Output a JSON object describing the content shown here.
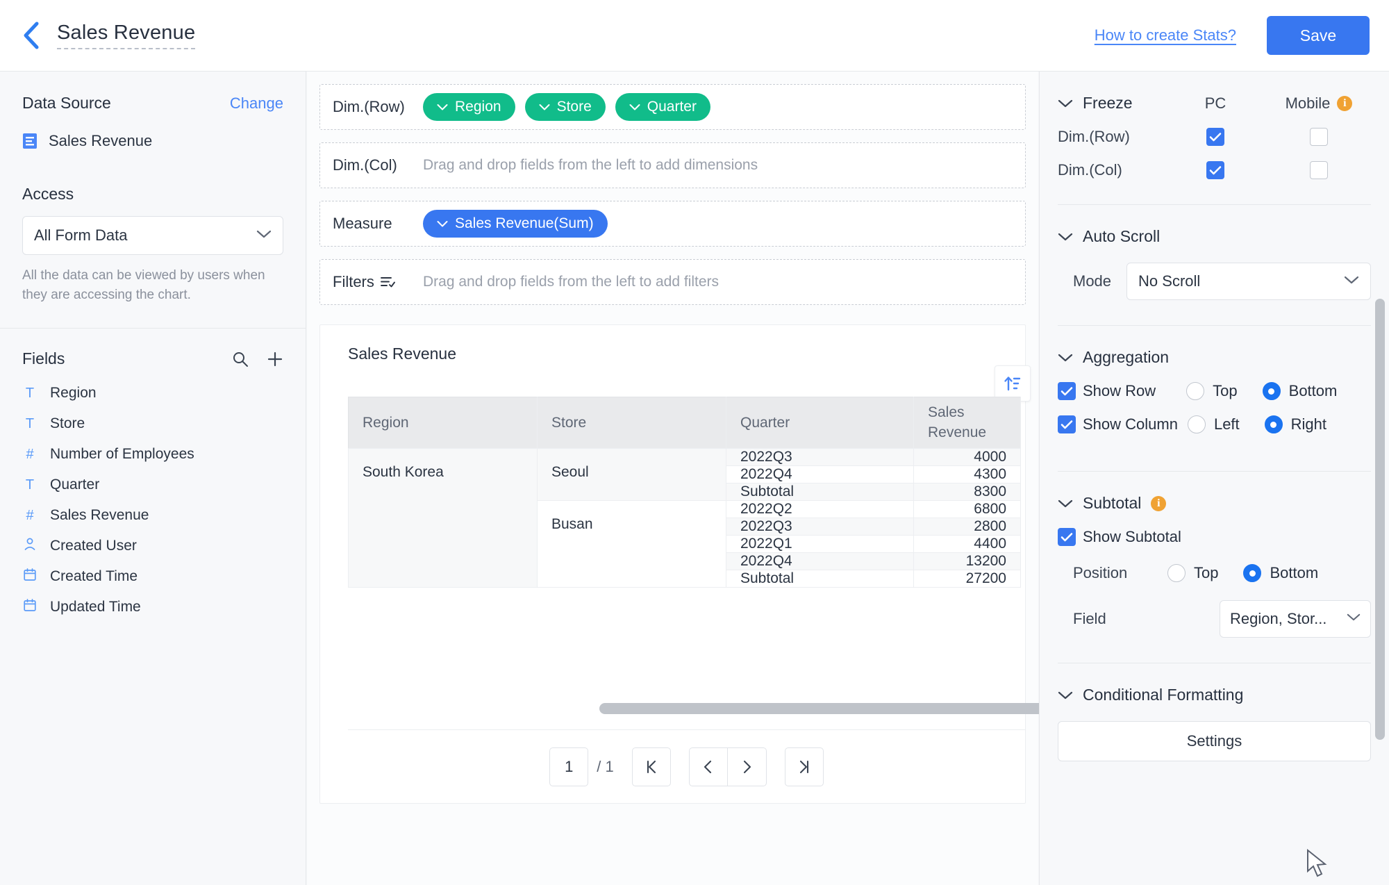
{
  "header": {
    "back_icon": "chevron-left-icon",
    "title": "Sales Revenue",
    "help_link": "How to create Stats?",
    "save_label": "Save",
    "accent": "#3877f0"
  },
  "sidebar": {
    "data_source_label": "Data Source",
    "change_label": "Change",
    "data_source_name": "Sales Revenue",
    "data_source_icon": "form-icon",
    "access_label": "Access",
    "access_value": "All Form Data",
    "access_hint": "All the data can be viewed by users when they are accessing the chart.",
    "fields_label": "Fields",
    "search_icon": "search-icon",
    "add_icon": "plus-icon",
    "fields": [
      {
        "name": "Region",
        "type_icon": "text-icon",
        "glyph": "T"
      },
      {
        "name": "Store",
        "type_icon": "text-icon",
        "glyph": "T"
      },
      {
        "name": "Number of Employees",
        "type_icon": "number-icon",
        "glyph": "#"
      },
      {
        "name": "Quarter",
        "type_icon": "text-icon",
        "glyph": "T"
      },
      {
        "name": "Sales Revenue",
        "type_icon": "number-icon",
        "glyph": "#"
      },
      {
        "name": "Created User",
        "type_icon": "user-icon",
        "glyph": "user"
      },
      {
        "name": "Created Time",
        "type_icon": "calendar-icon",
        "glyph": "cal"
      },
      {
        "name": "Updated Time",
        "type_icon": "calendar-icon",
        "glyph": "cal"
      }
    ]
  },
  "builder": {
    "dim_row_label": "Dim.(Row)",
    "dim_row_chips": [
      "Region",
      "Store",
      "Quarter"
    ],
    "dim_col_label": "Dim.(Col)",
    "dim_col_placeholder": "Drag and drop fields from the left to add dimensions",
    "measure_label": "Measure",
    "measure_chips": [
      "Sales Revenue(Sum)"
    ],
    "filters_label": "Filters",
    "filters_icon": "filter-icon",
    "filters_placeholder": "Drag and drop fields from the left to add filters",
    "dim_chip_color": "#11bc8a",
    "measure_chip_color": "#3877f0"
  },
  "preview": {
    "title": "Sales Revenue",
    "sort_icon": "sort-ascending-icon",
    "pagination": {
      "current_page": "1",
      "total_pages": "/ 1",
      "first_icon": "page-first-icon",
      "prev_icon": "page-prev-icon",
      "next_icon": "page-next-icon",
      "last_icon": "page-last-icon"
    }
  },
  "chart_data": {
    "type": "table",
    "title": "Sales Revenue",
    "columns": [
      "Region",
      "Store",
      "Quarter",
      "Sales Revenue"
    ],
    "rows": [
      {
        "region": "South Korea",
        "store": "Seoul",
        "quarter": "2022Q3",
        "value": "4000",
        "subtotal": false,
        "tint": true
      },
      {
        "region": "",
        "store": "",
        "quarter": "2022Q4",
        "value": "4300",
        "subtotal": false,
        "tint": false
      },
      {
        "region": "",
        "store": "",
        "quarter": "Subtotal",
        "value": "8300",
        "subtotal": true,
        "tint": true
      },
      {
        "region": "",
        "store": "Busan",
        "quarter": "2022Q2",
        "value": "6800",
        "subtotal": false,
        "tint": false
      },
      {
        "region": "",
        "store": "",
        "quarter": "2022Q3",
        "value": "2800",
        "subtotal": false,
        "tint": true
      },
      {
        "region": "",
        "store": "",
        "quarter": "2022Q1",
        "value": "4400",
        "subtotal": false,
        "tint": false
      },
      {
        "region": "",
        "store": "",
        "quarter": "2022Q4",
        "value": "13200",
        "subtotal": false,
        "tint": true
      },
      {
        "region": "",
        "store": "",
        "quarter": "Subtotal",
        "value": "27200",
        "subtotal": true,
        "tint": false
      }
    ]
  },
  "settings": {
    "freeze": {
      "section": "Freeze",
      "col_pc": "PC",
      "col_mobile": "Mobile",
      "mobile_info_icon": "info-icon",
      "rows": [
        {
          "label": "Dim.(Row)",
          "pc": true,
          "mobile": false
        },
        {
          "label": "Dim.(Col)",
          "pc": true,
          "mobile": false
        }
      ]
    },
    "auto_scroll": {
      "section": "Auto Scroll",
      "mode_label": "Mode",
      "mode_value": "No Scroll"
    },
    "aggregation": {
      "section": "Aggregation",
      "show_row_label": "Show Row",
      "show_row_checked": true,
      "row_options": [
        "Top",
        "Bottom"
      ],
      "row_selected": "Bottom",
      "show_column_label": "Show Column",
      "show_column_checked": true,
      "col_options": [
        "Left",
        "Right"
      ],
      "col_selected": "Right"
    },
    "subtotal": {
      "section": "Subtotal",
      "info_icon": "info-icon",
      "show_subtotal_label": "Show Subtotal",
      "show_subtotal_checked": true,
      "position_label": "Position",
      "position_options": [
        "Top",
        "Bottom"
      ],
      "position_selected": "Bottom",
      "field_label": "Field",
      "field_value": "Region, Stor..."
    },
    "conditional_formatting": {
      "section": "Conditional Formatting",
      "settings_label": "Settings"
    }
  }
}
